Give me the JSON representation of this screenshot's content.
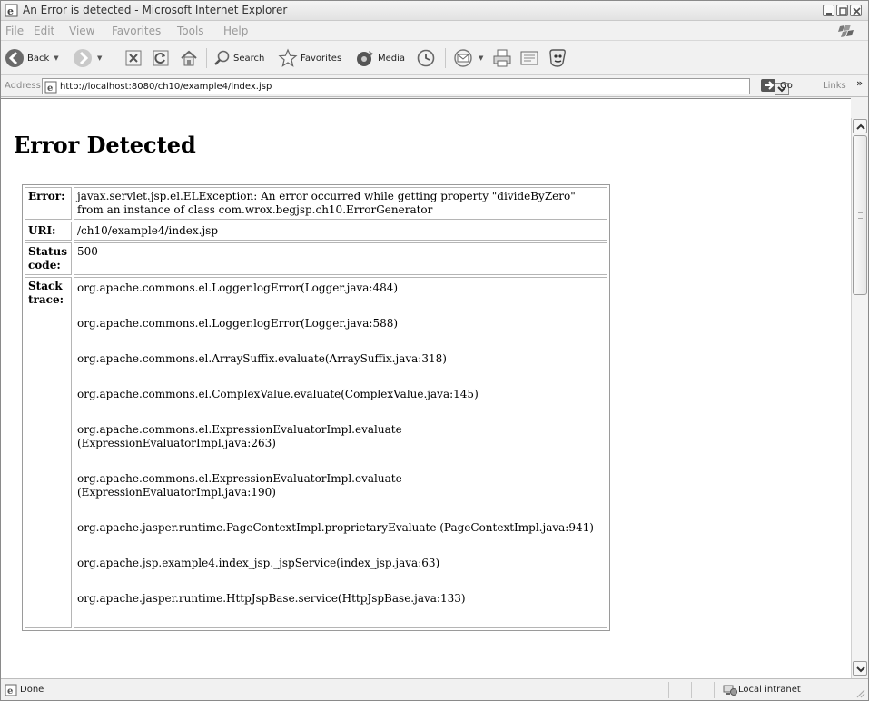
{
  "window": {
    "title": "An Error is detected - Microsoft Internet Explorer"
  },
  "menu": {
    "items": [
      "File",
      "Edit",
      "View",
      "Favorites",
      "Tools",
      "Help"
    ]
  },
  "toolbar": {
    "back_label": "Back",
    "search_label": "Search",
    "favorites_label": "Favorites",
    "media_label": "Media"
  },
  "address": {
    "label": "Address",
    "url": "http://localhost:8080/ch10/example4/index.jsp",
    "go_label": "Go",
    "links_label": "Links",
    "links_chevron": "»"
  },
  "page": {
    "heading": "Error Detected",
    "rows": {
      "error_label": "Error:",
      "error_value": "javax.servlet.jsp.el.ELException: An error occurred while getting property \"divideByZero\" from an instance of class com.wrox.begjsp.ch10.ErrorGenerator",
      "uri_label": "URI:",
      "uri_value": "/ch10/example4/index.jsp",
      "status_label": "Status code:",
      "status_value": "500",
      "stack_label": "Stack trace:"
    },
    "stack": [
      "org.apache.commons.el.Logger.logError(Logger.java:484)",
      "org.apache.commons.el.Logger.logError(Logger.java:588)",
      "org.apache.commons.el.ArraySuffix.evaluate(ArraySuffix.java:318)",
      "org.apache.commons.el.ComplexValue.evaluate(ComplexValue.java:145)",
      "org.apache.commons.el.ExpressionEvaluatorImpl.evaluate (ExpressionEvaluatorImpl.java:263)",
      "org.apache.commons.el.ExpressionEvaluatorImpl.evaluate (ExpressionEvaluatorImpl.java:190)",
      "org.apache.jasper.runtime.PageContextImpl.proprietaryEvaluate (PageContextImpl.java:941)",
      "org.apache.jsp.example4.index_jsp._jspService(index_jsp.java:63)",
      "org.apache.jasper.runtime.HttpJspBase.service(HttpJspBase.java:133)"
    ]
  },
  "status": {
    "text": "Done",
    "zone": "Local intranet"
  }
}
